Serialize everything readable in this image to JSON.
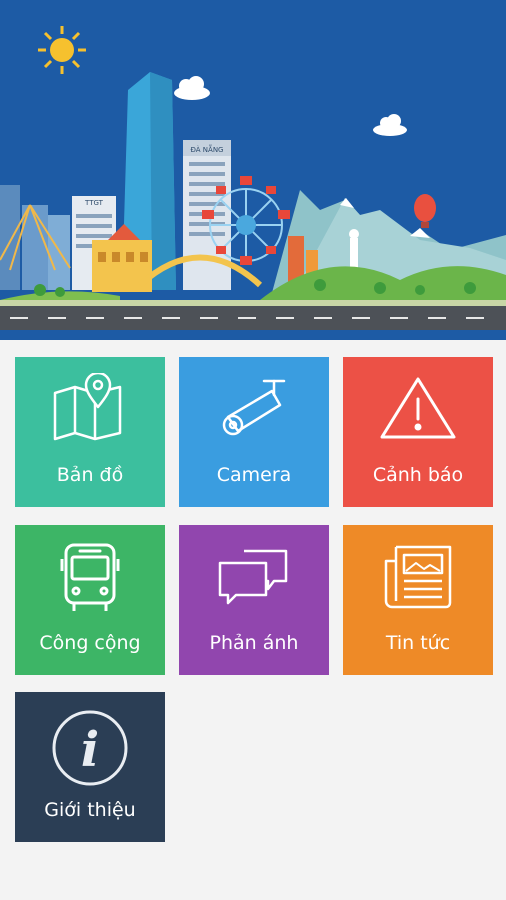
{
  "banner": {
    "billboard_text": "ĐÀ NẴNG",
    "sign_text": "TTGT"
  },
  "tiles": [
    {
      "label": "Bản đồ",
      "icon": "map-pin-icon",
      "color": "#3cbf9e"
    },
    {
      "label": "Camera",
      "icon": "camera-icon",
      "color": "#3a9de0"
    },
    {
      "label": "Cảnh báo",
      "icon": "warning-icon",
      "color": "#ec5146"
    },
    {
      "label": "Công cộng",
      "icon": "bus-icon",
      "color": "#3db566"
    },
    {
      "label": "Phản ánh",
      "icon": "chat-bubbles-icon",
      "color": "#9146ae"
    },
    {
      "label": "Tin tức",
      "icon": "newspaper-icon",
      "color": "#ee8a27"
    },
    {
      "label": "Giới thiệu",
      "icon": "info-icon",
      "color": "#2b3e55"
    }
  ]
}
